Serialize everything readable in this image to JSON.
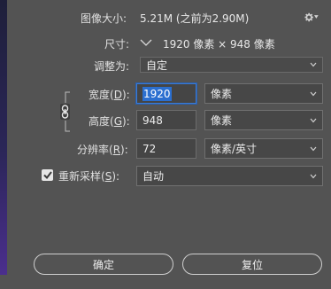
{
  "image_size": {
    "label": "图像大小:",
    "value": "5.21M (之前为2.90M)"
  },
  "dimensions": {
    "label": "尺寸:",
    "value": "1920 像素 × 948 像素"
  },
  "fit_to": {
    "label": "调整为:",
    "selected": "自定"
  },
  "width": {
    "label_prefix": "宽度(",
    "accel": "D",
    "label_suffix": "):",
    "value": "1920",
    "unit": "像素"
  },
  "height": {
    "label_prefix": "高度(",
    "accel": "G",
    "label_suffix": "):",
    "value": "948",
    "unit": "像素"
  },
  "resolution": {
    "label_prefix": "分辨率(",
    "accel": "R",
    "label_suffix": "):",
    "value": "72",
    "unit": "像素/英寸"
  },
  "resample": {
    "label_prefix": "重新采样(",
    "accel": "S",
    "label_suffix": "):",
    "checked": true,
    "selected": "自动"
  },
  "buttons": {
    "ok": "确定",
    "reset": "复位"
  },
  "icons": {
    "gear": "gear-icon",
    "dimensions_toggle": "chevron-down-icon",
    "link": "link-icon",
    "dropdown": "chevron-down-icon",
    "check": "check-icon"
  },
  "colors": {
    "background": "#535353",
    "focus_border": "#3b7bd6",
    "selection": "#2b6fd0"
  }
}
